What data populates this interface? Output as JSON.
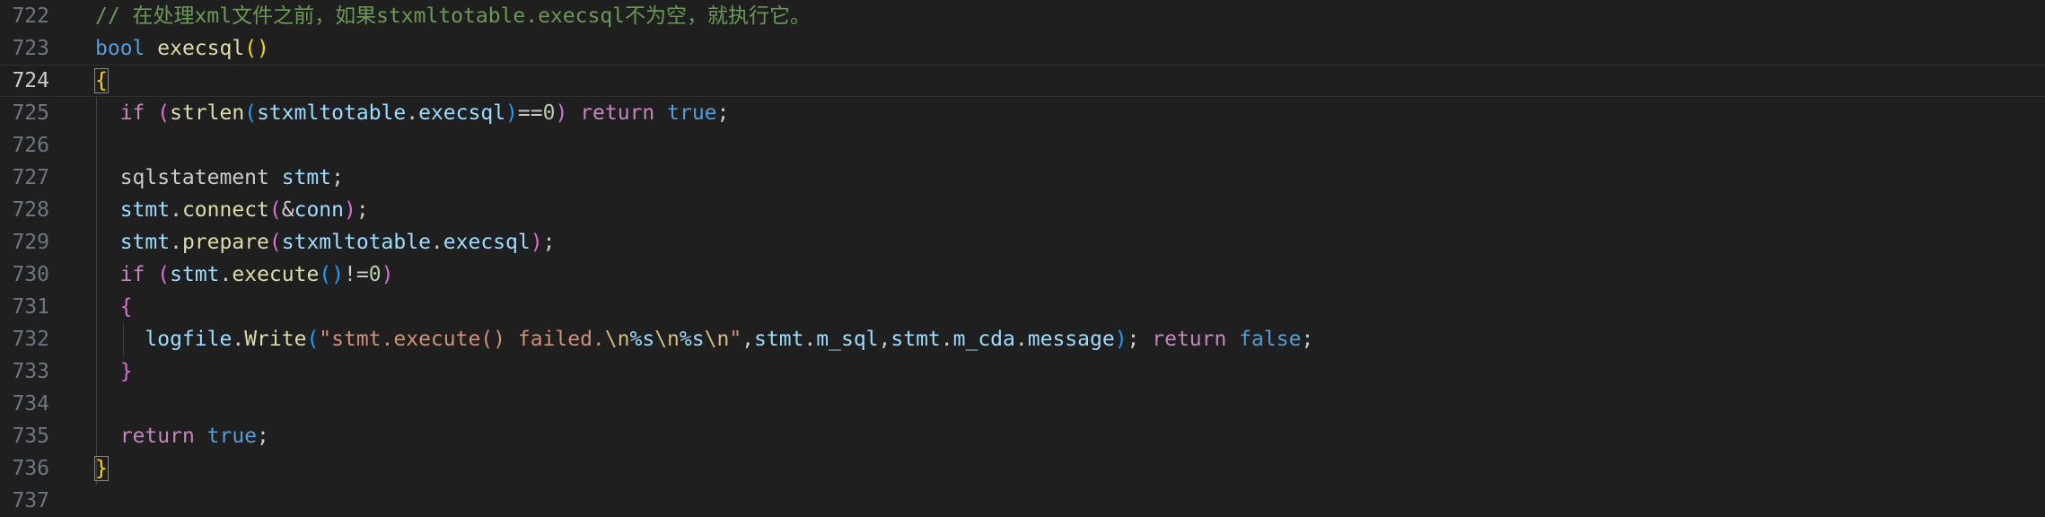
{
  "editor": {
    "lines": [
      {
        "number": "722",
        "tokens": [
          {
            "text": "// 在处理xml文件之前，如果stxmltotable.execsql不为空，就执行它。",
            "kind": "comment"
          }
        ]
      },
      {
        "number": "723",
        "tokens": [
          {
            "text": "bool",
            "kind": "keyword"
          },
          {
            "text": " ",
            "kind": "default"
          },
          {
            "text": "execsql",
            "kind": "function"
          },
          {
            "text": "()",
            "kind": "bracket1"
          }
        ]
      },
      {
        "number": "724",
        "current": true,
        "tokens": [
          {
            "text": "{",
            "kind": "bracket1",
            "box": true
          }
        ]
      },
      {
        "number": "725",
        "tokens": [
          {
            "text": "  ",
            "kind": "default"
          },
          {
            "text": "if",
            "kind": "control"
          },
          {
            "text": " ",
            "kind": "default"
          },
          {
            "text": "(",
            "kind": "bracket2"
          },
          {
            "text": "strlen",
            "kind": "function"
          },
          {
            "text": "(",
            "kind": "bracket3"
          },
          {
            "text": "stxmltotable",
            "kind": "variable"
          },
          {
            "text": ".",
            "kind": "default"
          },
          {
            "text": "execsql",
            "kind": "variable"
          },
          {
            "text": ")",
            "kind": "bracket3"
          },
          {
            "text": "==",
            "kind": "default"
          },
          {
            "text": "0",
            "kind": "number"
          },
          {
            "text": ")",
            "kind": "bracket2"
          },
          {
            "text": " ",
            "kind": "default"
          },
          {
            "text": "return",
            "kind": "control"
          },
          {
            "text": " ",
            "kind": "default"
          },
          {
            "text": "true",
            "kind": "keyword"
          },
          {
            "text": ";",
            "kind": "default"
          }
        ]
      },
      {
        "number": "726",
        "tokens": []
      },
      {
        "number": "727",
        "tokens": [
          {
            "text": "  sqlstatement ",
            "kind": "default"
          },
          {
            "text": "stmt",
            "kind": "variable"
          },
          {
            "text": ";",
            "kind": "default"
          }
        ]
      },
      {
        "number": "728",
        "tokens": [
          {
            "text": "  ",
            "kind": "default"
          },
          {
            "text": "stmt",
            "kind": "variable"
          },
          {
            "text": ".",
            "kind": "default"
          },
          {
            "text": "connect",
            "kind": "function"
          },
          {
            "text": "(",
            "kind": "bracket2"
          },
          {
            "text": "&",
            "kind": "default"
          },
          {
            "text": "conn",
            "kind": "variable"
          },
          {
            "text": ")",
            "kind": "bracket2"
          },
          {
            "text": ";",
            "kind": "default"
          }
        ]
      },
      {
        "number": "729",
        "tokens": [
          {
            "text": "  ",
            "kind": "default"
          },
          {
            "text": "stmt",
            "kind": "variable"
          },
          {
            "text": ".",
            "kind": "default"
          },
          {
            "text": "prepare",
            "kind": "function"
          },
          {
            "text": "(",
            "kind": "bracket2"
          },
          {
            "text": "stxmltotable",
            "kind": "variable"
          },
          {
            "text": ".",
            "kind": "default"
          },
          {
            "text": "execsql",
            "kind": "variable"
          },
          {
            "text": ")",
            "kind": "bracket2"
          },
          {
            "text": ";",
            "kind": "default"
          }
        ]
      },
      {
        "number": "730",
        "tokens": [
          {
            "text": "  ",
            "kind": "default"
          },
          {
            "text": "if",
            "kind": "control"
          },
          {
            "text": " ",
            "kind": "default"
          },
          {
            "text": "(",
            "kind": "bracket2"
          },
          {
            "text": "stmt",
            "kind": "variable"
          },
          {
            "text": ".",
            "kind": "default"
          },
          {
            "text": "execute",
            "kind": "function"
          },
          {
            "text": "()",
            "kind": "bracket3"
          },
          {
            "text": "!=",
            "kind": "default"
          },
          {
            "text": "0",
            "kind": "number"
          },
          {
            "text": ")",
            "kind": "bracket2"
          }
        ]
      },
      {
        "number": "731",
        "tokens": [
          {
            "text": "  ",
            "kind": "default"
          },
          {
            "text": "{",
            "kind": "bracket2"
          }
        ]
      },
      {
        "number": "732",
        "tokens": [
          {
            "text": "    ",
            "kind": "default"
          },
          {
            "text": "logfile",
            "kind": "variable"
          },
          {
            "text": ".",
            "kind": "default"
          },
          {
            "text": "Write",
            "kind": "function"
          },
          {
            "text": "(",
            "kind": "bracket3"
          },
          {
            "text": "\"stmt.execute() failed.",
            "kind": "string"
          },
          {
            "text": "\\n",
            "kind": "escape"
          },
          {
            "text": "%s",
            "kind": "variable"
          },
          {
            "text": "\\n",
            "kind": "escape"
          },
          {
            "text": "%s",
            "kind": "variable"
          },
          {
            "text": "\\n",
            "kind": "escape"
          },
          {
            "text": "\"",
            "kind": "string"
          },
          {
            "text": ",",
            "kind": "default"
          },
          {
            "text": "stmt",
            "kind": "variable"
          },
          {
            "text": ".",
            "kind": "default"
          },
          {
            "text": "m_sql",
            "kind": "variable"
          },
          {
            "text": ",",
            "kind": "default"
          },
          {
            "text": "stmt",
            "kind": "variable"
          },
          {
            "text": ".",
            "kind": "default"
          },
          {
            "text": "m_cda",
            "kind": "variable"
          },
          {
            "text": ".",
            "kind": "default"
          },
          {
            "text": "message",
            "kind": "variable"
          },
          {
            "text": ")",
            "kind": "bracket3"
          },
          {
            "text": "; ",
            "kind": "default"
          },
          {
            "text": "return",
            "kind": "control"
          },
          {
            "text": " ",
            "kind": "default"
          },
          {
            "text": "false",
            "kind": "keyword"
          },
          {
            "text": ";",
            "kind": "default"
          }
        ]
      },
      {
        "number": "733",
        "tokens": [
          {
            "text": "  ",
            "kind": "default"
          },
          {
            "text": "}",
            "kind": "bracket2"
          }
        ]
      },
      {
        "number": "734",
        "tokens": []
      },
      {
        "number": "735",
        "tokens": [
          {
            "text": "  ",
            "kind": "default"
          },
          {
            "text": "return",
            "kind": "control"
          },
          {
            "text": " ",
            "kind": "default"
          },
          {
            "text": "true",
            "kind": "keyword"
          },
          {
            "text": ";",
            "kind": "default"
          }
        ]
      },
      {
        "number": "736",
        "tokens": [
          {
            "text": "}",
            "kind": "bracket1",
            "box": true
          }
        ]
      },
      {
        "number": "737",
        "tokens": []
      }
    ]
  }
}
